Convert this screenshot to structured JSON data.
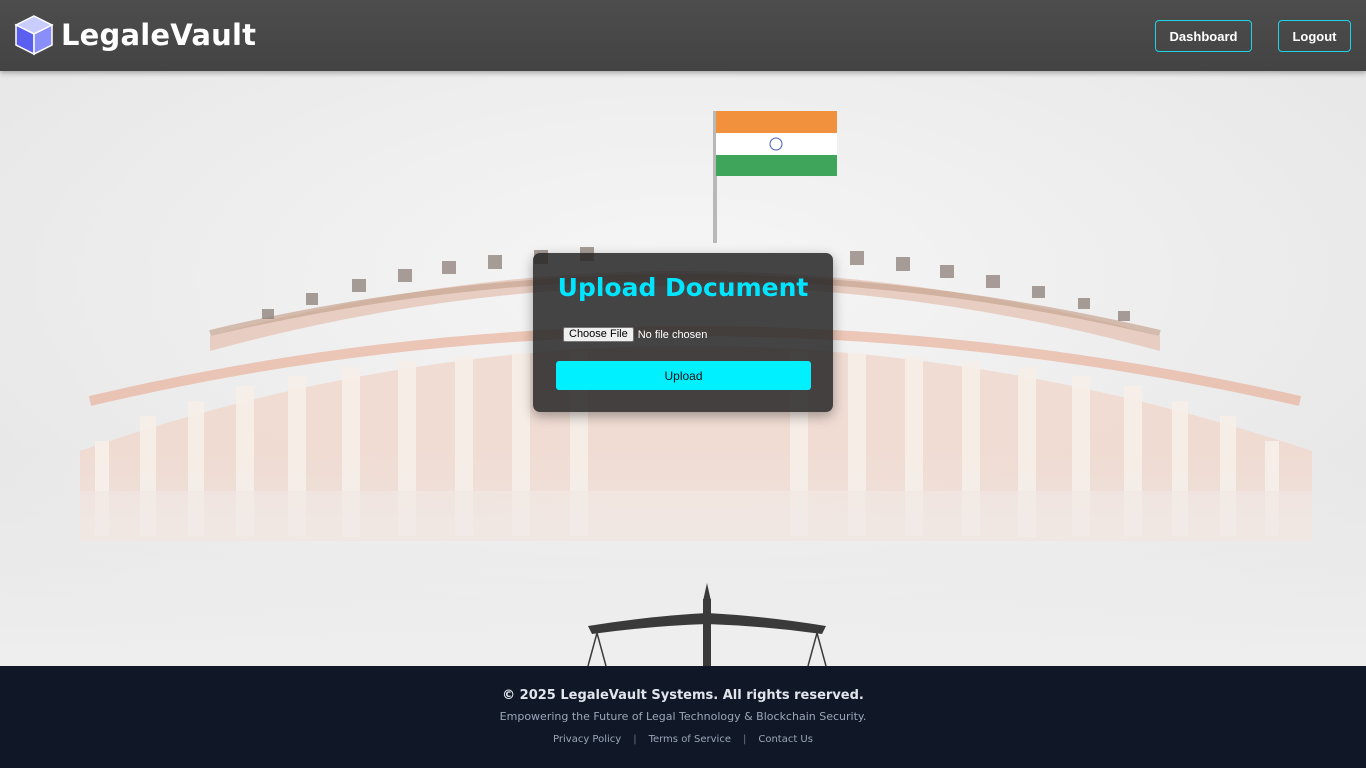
{
  "header": {
    "brand": "LegaleVault",
    "dashboard_label": "Dashboard",
    "logout_label": "Logout",
    "logo_icon": "cube-icon"
  },
  "upload_card": {
    "title": "Upload Document",
    "choose_file_label": "Choose File",
    "file_status": "No file chosen",
    "upload_label": "Upload"
  },
  "footer": {
    "copyright": "© 2025 LegaleVault Systems. All rights reserved.",
    "tagline": "Empowering the Future of Legal Technology & Blockchain Security.",
    "links": [
      "Privacy Policy",
      "Terms of Service",
      "Contact Us"
    ],
    "separator": "|"
  },
  "colors": {
    "accent": "#00e5ff",
    "header_bg": "#474747",
    "footer_bg": "#101828",
    "card_bg": "#262626"
  }
}
